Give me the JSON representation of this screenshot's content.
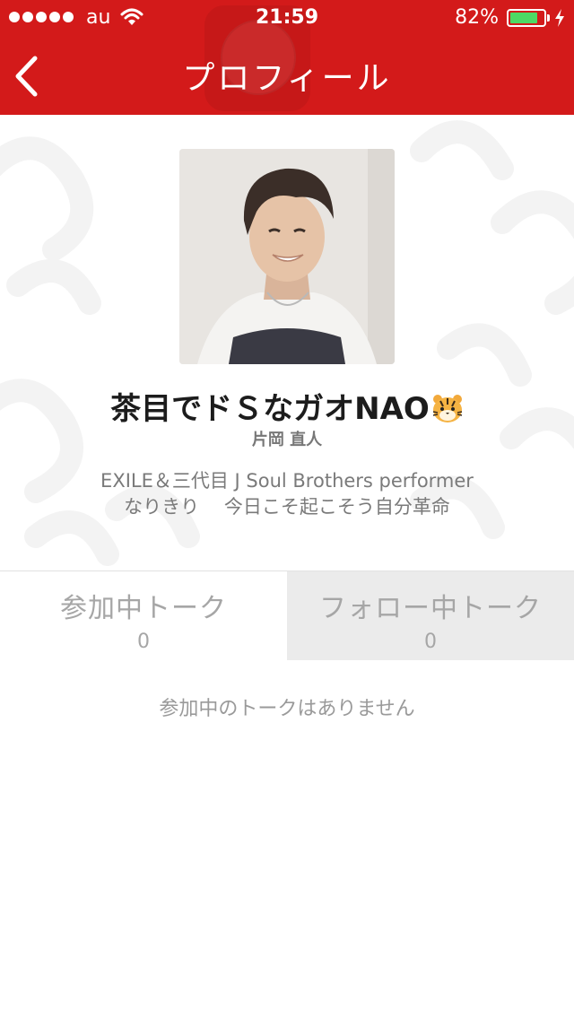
{
  "status_bar": {
    "carrier": "au",
    "time": "21:59",
    "battery_percent": "82%",
    "battery_level": 0.82,
    "signal_bars": 5
  },
  "nav": {
    "title": "プロフィール",
    "back_icon": "chevron-left-icon"
  },
  "profile": {
    "display_name": "茶目でドＳなガオNAO",
    "display_name_emoji": "tiger-face-icon",
    "real_name": "片岡 直人",
    "bio_lines": [
      "EXILE＆三代目 J Soul Brothers performer",
      "なりきり　 今日こそ起こそう自分革命"
    ]
  },
  "tabs": [
    {
      "label": "参加中トーク",
      "count": "0",
      "selected": true
    },
    {
      "label": "フォロー中トーク",
      "count": "0",
      "selected": false
    }
  ],
  "empty_message": "参加中のトークはありません",
  "colors": {
    "header": "#d31a1a",
    "battery": "#4cd964",
    "inactive_tab": "#ebebeb",
    "muted_text": "#a6a6a6"
  }
}
